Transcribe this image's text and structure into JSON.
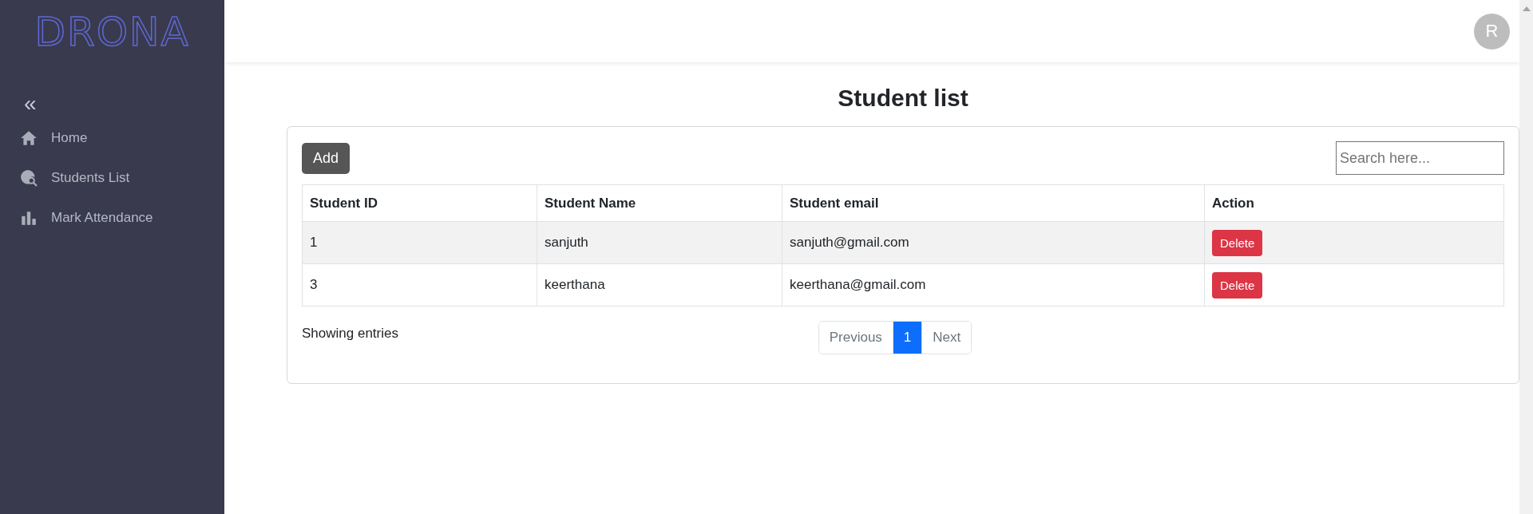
{
  "sidebar": {
    "logo": "DRONA",
    "collapse": "«",
    "items": [
      {
        "kind": "home",
        "label": "Home"
      },
      {
        "kind": "search",
        "label": "Students List"
      },
      {
        "kind": "chart",
        "label": "Mark Attendance"
      }
    ]
  },
  "header": {
    "avatar": "R"
  },
  "page": {
    "title": "Student list",
    "add_button": "Add",
    "search": {
      "placeholder": "Search here..."
    },
    "table": {
      "columns": [
        "Student ID",
        "Student Name",
        "Student email",
        "Action"
      ],
      "rows": [
        {
          "id": "1",
          "name": "sanjuth",
          "email": "sanjuth@gmail.com",
          "action": "Delete"
        },
        {
          "id": "3",
          "name": "keerthana",
          "email": "keerthana@gmail.com",
          "action": "Delete"
        }
      ]
    },
    "info": "Showing entries",
    "pagination": {
      "previous": "Previous",
      "pages": [
        {
          "label": "1",
          "selected": true
        }
      ],
      "next": "Next"
    }
  }
}
